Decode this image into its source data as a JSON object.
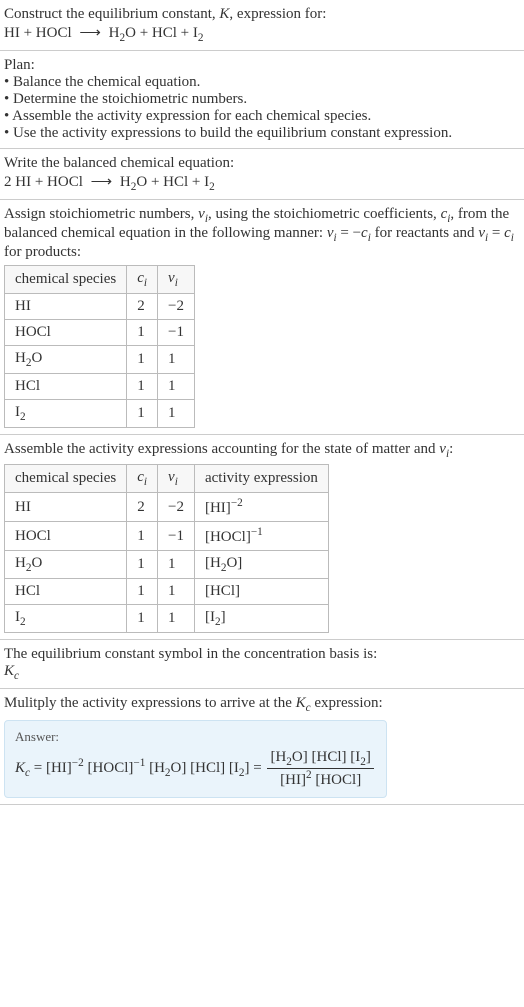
{
  "intro": {
    "lead_text": "Construct the equilibrium constant, ",
    "K": "K",
    "lead_text2": ", expression for:",
    "equation_html": "HI + HOCl <span class='arrow'>⟶</span> H<sub>2</sub>O + HCl + I<sub>2</sub>"
  },
  "plan": {
    "heading": "Plan:",
    "items": [
      "Balance the chemical equation.",
      "Determine the stoichiometric numbers.",
      "Assemble the activity expression for each chemical species.",
      "Use the activity expressions to build the equilibrium constant expression."
    ]
  },
  "balanced": {
    "heading": "Write the balanced chemical equation:",
    "equation_html": "2 HI + HOCl <span class='arrow'>⟶</span> H<sub>2</sub>O + HCl + I<sub>2</sub>"
  },
  "stoich": {
    "intro_html": "Assign stoichiometric numbers, <span class='ital'>ν<sub>i</sub></span>, using the stoichiometric coefficients, <span class='ital'>c<sub>i</sub></span>, from the balanced chemical equation in the following manner: <span class='ital'>ν<sub>i</sub></span> = −<span class='ital'>c<sub>i</sub></span> for reactants and <span class='ital'>ν<sub>i</sub></span> = <span class='ital'>c<sub>i</sub></span> for products:",
    "headers": {
      "species": "chemical species",
      "c": "c<sub>i</sub>",
      "nu": "ν<sub>i</sub>"
    },
    "rows": [
      {
        "species": "HI",
        "c": "2",
        "nu": "−2"
      },
      {
        "species": "HOCl",
        "c": "1",
        "nu": "−1"
      },
      {
        "species": "H<sub>2</sub>O",
        "c": "1",
        "nu": "1"
      },
      {
        "species": "HCl",
        "c": "1",
        "nu": "1"
      },
      {
        "species": "I<sub>2</sub>",
        "c": "1",
        "nu": "1"
      }
    ]
  },
  "activity": {
    "intro_html": "Assemble the activity expressions accounting for the state of matter and <span class='ital'>ν<sub>i</sub></span>:",
    "headers": {
      "species": "chemical species",
      "c": "c<sub>i</sub>",
      "nu": "ν<sub>i</sub>",
      "expr": "activity expression"
    },
    "rows": [
      {
        "species": "HI",
        "c": "2",
        "nu": "−2",
        "expr": "[HI]<sup>−2</sup>"
      },
      {
        "species": "HOCl",
        "c": "1",
        "nu": "−1",
        "expr": "[HOCl]<sup>−1</sup>"
      },
      {
        "species": "H<sub>2</sub>O",
        "c": "1",
        "nu": "1",
        "expr": "[H<sub>2</sub>O]"
      },
      {
        "species": "HCl",
        "c": "1",
        "nu": "1",
        "expr": "[HCl]"
      },
      {
        "species": "I<sub>2</sub>",
        "c": "1",
        "nu": "1",
        "expr": "[I<sub>2</sub>]"
      }
    ]
  },
  "kc_symbol": {
    "line1": "The equilibrium constant symbol in the concentration basis is:",
    "line2_html": "<span class='ital'>K<sub>c</sub></span>"
  },
  "final": {
    "heading_html": "Mulitply the activity expressions to arrive at the <span class='ital'>K<sub>c</sub></span> expression:",
    "answer_label": "Answer:",
    "lhs_html": "<span class='ital'>K<sub>c</sub></span> = [HI]<sup>−2</sup> [HOCl]<sup>−1</sup> [H<sub>2</sub>O] [HCl] [I<sub>2</sub>] = ",
    "frac_num_html": "[H<sub>2</sub>O] [HCl] [I<sub>2</sub>]",
    "frac_den_html": "[HI]<sup>2</sup> [HOCl]"
  },
  "chart_data": {
    "type": "table",
    "tables": [
      {
        "title": "Stoichiometric numbers",
        "columns": [
          "chemical species",
          "c_i",
          "nu_i"
        ],
        "rows": [
          [
            "HI",
            2,
            -2
          ],
          [
            "HOCl",
            1,
            -1
          ],
          [
            "H2O",
            1,
            1
          ],
          [
            "HCl",
            1,
            1
          ],
          [
            "I2",
            1,
            1
          ]
        ]
      },
      {
        "title": "Activity expressions",
        "columns": [
          "chemical species",
          "c_i",
          "nu_i",
          "activity expression"
        ],
        "rows": [
          [
            "HI",
            2,
            -2,
            "[HI]^-2"
          ],
          [
            "HOCl",
            1,
            -1,
            "[HOCl]^-1"
          ],
          [
            "H2O",
            1,
            1,
            "[H2O]"
          ],
          [
            "HCl",
            1,
            1,
            "[HCl]"
          ],
          [
            "I2",
            1,
            1,
            "[I2]"
          ]
        ]
      }
    ]
  }
}
